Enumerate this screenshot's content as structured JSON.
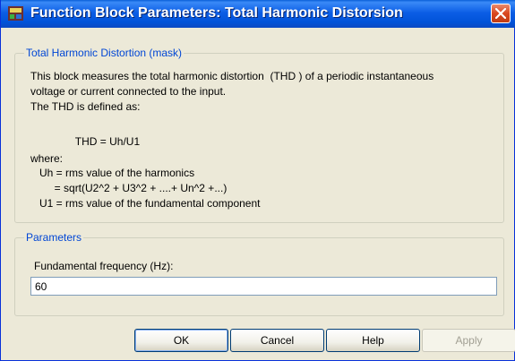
{
  "window": {
    "title": "Function Block Parameters: Total Harmonic Distorsion"
  },
  "description_group": {
    "legend": "Total Harmonic Distortion (mask)",
    "lines": [
      "This block measures the total harmonic distortion  (THD ) of a periodic instantaneous",
      "voltage or current connected to the input.",
      "The THD is defined as:",
      "",
      "               THD = Uh/U1",
      "where:",
      "   Uh = rms value of the harmonics",
      "        = sqrt(U2^2 + U3^2 + ....+ Un^2 +...)",
      "   U1 = rms value of the fundamental component"
    ]
  },
  "parameters_group": {
    "legend": "Parameters",
    "fields": [
      {
        "label": "Fundamental frequency (Hz):",
        "value": "60"
      }
    ]
  },
  "buttons": {
    "ok": "OK",
    "cancel": "Cancel",
    "help": "Help",
    "apply": "Apply"
  },
  "icons": {
    "title_icon": "simulink-block-icon",
    "close": "close-icon"
  },
  "colors": {
    "title_bar": "#0153d8",
    "legend_text": "#0046d5",
    "close_button": "#d9471f",
    "dialog_background": "#ece9d8"
  }
}
